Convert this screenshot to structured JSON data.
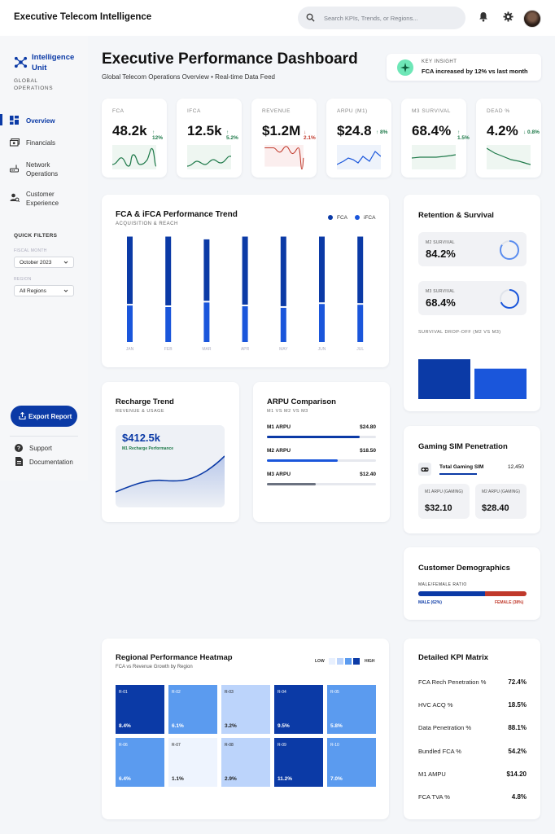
{
  "app": {
    "title": "Executive Telecom Intelligence"
  },
  "search": {
    "placeholder": "Search KPIs, Trends, or Regions..."
  },
  "sidebar": {
    "unit_name": "Intelligence Unit",
    "unit_sub": "GLOBAL OPERATIONS",
    "nav": [
      {
        "label": "Overview",
        "icon": "dashboard-icon",
        "active": true
      },
      {
        "label": "Financials",
        "icon": "money-icon"
      },
      {
        "label": "Network Operations",
        "icon": "router-icon"
      },
      {
        "label": "Customer Experience",
        "icon": "customer-icon"
      }
    ],
    "quick_filters": "QUICK FILTERS",
    "fiscal_month_label": "FISCAL MONTH",
    "fiscal_month_value": "October 2023",
    "region_label": "REGION",
    "region_value": "All Regions",
    "export_label": "Export Report",
    "support_label": "Support",
    "docs_label": "Documentation"
  },
  "header": {
    "title": "Executive Performance Dashboard",
    "subtitle": "Global Telecom Operations Overview • Real-time Data Feed",
    "insight_label": "KEY INSIGHT",
    "insight_text": "FCA increased by 12% vs last month"
  },
  "kpis": [
    {
      "label": "FCA",
      "value": "48.2k",
      "delta": "↑ 12%",
      "trend": "up"
    },
    {
      "label": "IFCA",
      "value": "12.5k",
      "delta": "↑ 5.2%",
      "trend": "up"
    },
    {
      "label": "REVENUE",
      "value": "$1.2M",
      "delta": "↓ 2.1%",
      "trend": "down"
    },
    {
      "label": "ARPU (M1)",
      "value": "$24.8",
      "delta": "↑ 8%",
      "trend": "up"
    },
    {
      "label": "M3 SURVIVAL",
      "value": "68.4%",
      "delta": "↑ 1.5%",
      "trend": "up"
    },
    {
      "label": "DEAD %",
      "value": "4.2%",
      "delta": "↓ 0.8%",
      "trend": "up"
    }
  ],
  "colors": {
    "primary": "#0b3aa6",
    "secondary": "#1a56db",
    "up": "#1f7a4a",
    "down": "#c0392b"
  },
  "trend_card": {
    "title": "FCA & iFCA Performance Trend",
    "subtitle": "ACQUISITION & REACH"
  },
  "chart_data": {
    "type": "bar",
    "title": "FCA & iFCA Performance Trend",
    "categories": [
      "JAN",
      "FEB",
      "MAR",
      "APR",
      "MAY",
      "JUN",
      "JUL"
    ],
    "series": [
      {
        "name": "FCA",
        "values": [
          75,
          75,
          73,
          75,
          75,
          75,
          75
        ]
      },
      {
        "name": "iFCA",
        "values": [
          48,
          46,
          52,
          47,
          45,
          50,
          49
        ]
      }
    ],
    "stacked": true,
    "legend": "top-right"
  },
  "retention": {
    "title": "Retention & Survival",
    "m2_label": "M2 SURVIVAL",
    "m2_value": "84.2%",
    "m2_pct": 84.2,
    "m3_label": "M3 SURVIVAL",
    "m3_value": "68.4%",
    "m3_pct": 68.4,
    "dropoff_label": "SURVIVAL DROP-OFF (M2 VS M3)"
  },
  "recharge": {
    "title": "Recharge Trend",
    "subtitle": "REVENUE & USAGE",
    "value": "$412.5k",
    "value_sub": "M1 Recharge Performance"
  },
  "arpu": {
    "title": "ARPU Comparison",
    "subtitle": "M1 VS M2 VS M3",
    "rows": [
      {
        "label": "M1 ARPU",
        "value": "$24.80",
        "pct": 0.85
      },
      {
        "label": "M2 ARPU",
        "value": "$18.50",
        "pct": 0.65
      },
      {
        "label": "M3 ARPU",
        "value": "$12.40",
        "pct": 0.45
      }
    ]
  },
  "gaming": {
    "title": "Gaming SIM Penetration",
    "total_label": "Total Gaming SIM",
    "total_value": "12,450",
    "m1_label": "M1 ARPU (GAMING)",
    "m1_value": "$32.10",
    "m2_label": "M2 ARPU (GAMING)",
    "m2_value": "$28.40"
  },
  "demographics": {
    "title": "Customer Demographics",
    "ratio_label": "MALE/FEMALE RATIO",
    "male_label": "MALE (62%)",
    "female_label": "FEMALE (38%)",
    "male_pct": 62
  },
  "heatmap": {
    "title": "Regional Performance Heatmap",
    "subtitle": "FCA vs Revenue Growth by Region",
    "low": "LOW",
    "high": "HIGH",
    "cells": [
      {
        "label": "R-01",
        "value": "8.4%"
      },
      {
        "label": "R-02",
        "value": "6.1%"
      },
      {
        "label": "R-03",
        "value": "3.2%"
      },
      {
        "label": "R-04",
        "value": "9.5%"
      },
      {
        "label": "R-05",
        "value": "5.8%"
      },
      {
        "label": "R-06",
        "value": "6.4%"
      },
      {
        "label": "R-07",
        "value": "1.1%"
      },
      {
        "label": "R-08",
        "value": "2.9%"
      },
      {
        "label": "R-09",
        "value": "11.2%"
      },
      {
        "label": "R-10",
        "value": "7.0%"
      }
    ]
  },
  "matrix": {
    "title": "Detailed KPI Matrix",
    "rows": [
      {
        "label": "FCA Rech Penetration %",
        "value": "72.4%"
      },
      {
        "label": "HVC ACQ %",
        "value": "18.5%"
      },
      {
        "label": "Data Penetration %",
        "value": "88.1%"
      },
      {
        "label": "Bundled FCA %",
        "value": "54.2%"
      },
      {
        "label": "M1 AMPU",
        "value": "$14.20"
      },
      {
        "label": "FCA TVA %",
        "value": "4.8%"
      }
    ]
  }
}
